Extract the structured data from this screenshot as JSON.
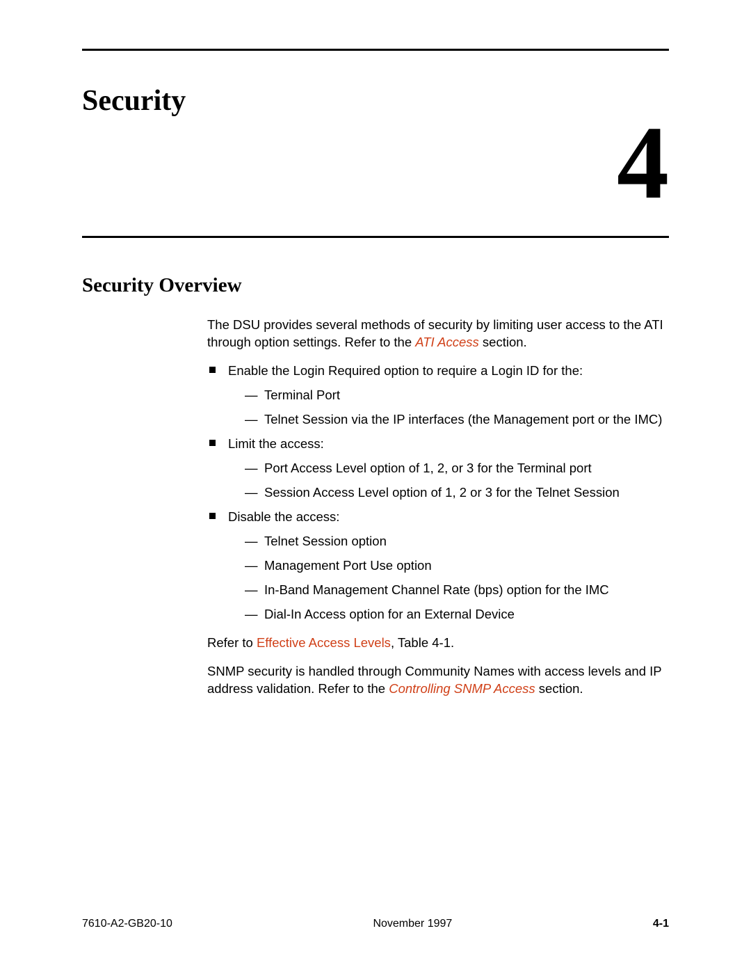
{
  "chapter": {
    "title": "Security",
    "number": "4"
  },
  "section": {
    "title": "Security Overview"
  },
  "intro": {
    "before_link": "The DSU provides several methods of security by limiting user access to the ATI through option settings. Refer to the ",
    "link": "ATI Access",
    "after_link": " section."
  },
  "bullets": [
    {
      "lead": "Enable the Login Required option to require a Login ID for the:",
      "subs": [
        "Terminal Port",
        "Telnet Session via the IP interfaces (the Management port or the IMC)"
      ]
    },
    {
      "lead": "Limit the access:",
      "subs": [
        "Port Access Level option of 1, 2, or 3 for the Terminal port",
        "Session Access Level option of 1, 2 or 3 for the Telnet Session"
      ]
    },
    {
      "lead": "Disable the access:",
      "subs": [
        "Telnet Session option",
        "Management Port Use option",
        "In-Band Management Channel Rate (bps) option for the IMC",
        "Dial-In Access option for an External Device"
      ]
    }
  ],
  "refer1": {
    "before": "Refer to ",
    "link": "Effective Access Levels",
    "after": ", Table 4-1."
  },
  "snmp": {
    "before": "SNMP security is handled through Community Names with access levels and IP address validation. Refer to the ",
    "link": "Controlling SNMP Access",
    "after": " section."
  },
  "footer": {
    "docid": "7610-A2-GB20-10",
    "date": "November 1997",
    "page": "4-1"
  }
}
